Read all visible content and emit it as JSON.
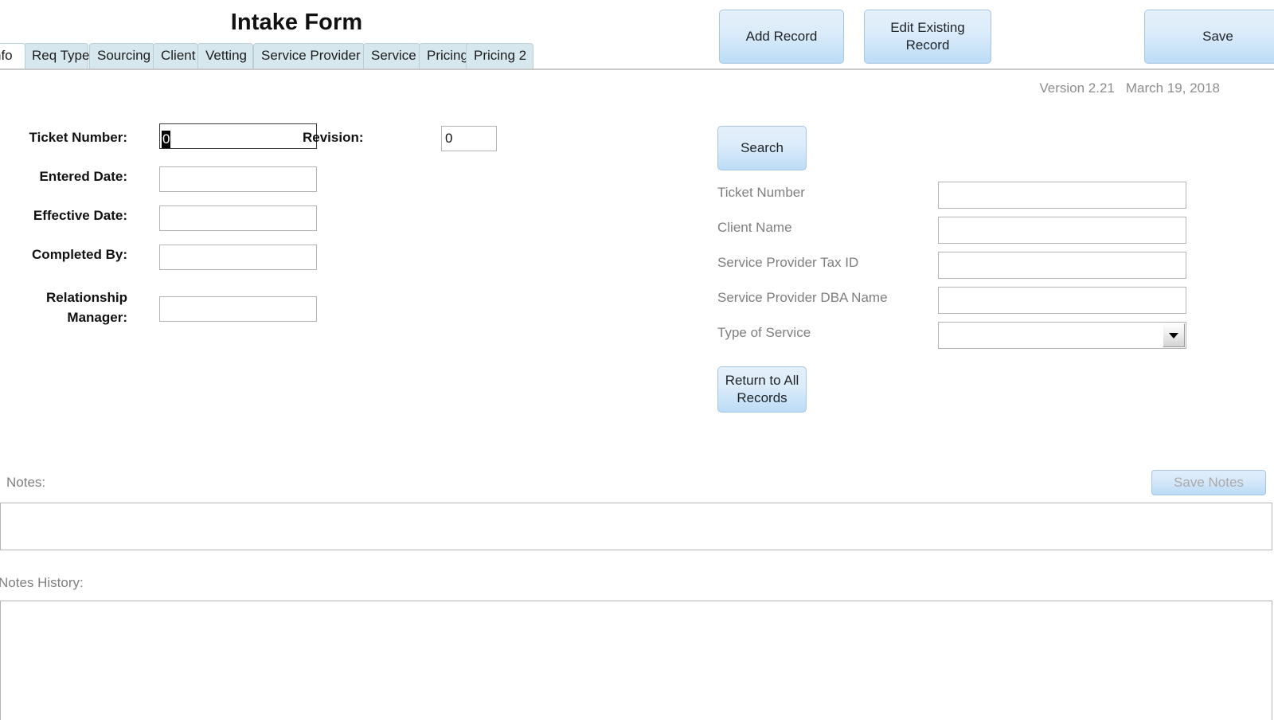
{
  "header": {
    "title": "Intake Form",
    "buttons": {
      "add_record": "Add Record",
      "edit_existing_record": "Edit Existing Record",
      "save": "Save"
    }
  },
  "tabs": {
    "active_index": 0,
    "items": [
      {
        "label": "nfo",
        "active": true
      },
      {
        "label": "Req Type",
        "active": false
      },
      {
        "label": "Sourcing",
        "active": false
      },
      {
        "label": "Client",
        "active": false
      },
      {
        "label": "Vetting",
        "active": false
      },
      {
        "label": "Service Provider",
        "active": false
      },
      {
        "label": "Service",
        "active": false
      },
      {
        "label": "Pricing",
        "active": false
      },
      {
        "label": "Pricing 2",
        "active": false
      }
    ]
  },
  "version_info": {
    "version": "Version 2.21",
    "date": "March 19, 2018"
  },
  "form": {
    "fields": [
      {
        "label": "Ticket Number:",
        "value": "0",
        "focused": true,
        "selected": true
      },
      {
        "label": "Entered Date:",
        "value": "",
        "focused": false,
        "selected": false
      },
      {
        "label": "Effective Date:",
        "value": "",
        "focused": false,
        "selected": false
      },
      {
        "label": "Completed By:",
        "value": "",
        "focused": false,
        "selected": false
      },
      {
        "label": "Relationship Manager:",
        "label_line1": "Relationship",
        "label_line2": "Manager:",
        "value": "",
        "focused": false,
        "selected": false
      }
    ],
    "revision": {
      "label": "Revision:",
      "value": "0"
    }
  },
  "search_panel": {
    "search_button": "Search",
    "return_button": "Return to All Records",
    "rows": [
      {
        "label": "Ticket Number",
        "value": "",
        "type": "text"
      },
      {
        "label": "Client Name",
        "value": "",
        "type": "text"
      },
      {
        "label": "Service Provider Tax ID",
        "value": "",
        "type": "text"
      },
      {
        "label": "Service Provider DBA Name",
        "value": "",
        "type": "text"
      },
      {
        "label": "Type of Service",
        "value": "",
        "type": "select"
      }
    ]
  },
  "notes": {
    "label": "Notes:",
    "save_button": "Save Notes",
    "value": "",
    "history_label": "Notes History:",
    "history_value": ""
  },
  "colors": {
    "accent_button": "#bcdcf7",
    "button_border": "#a8c6e0",
    "tab_inactive": "#d6e8ed",
    "tab_active": "#ffffff",
    "muted_text": "#7f7f7f",
    "field_border": "#b4b4b4",
    "selection": "#000000"
  }
}
